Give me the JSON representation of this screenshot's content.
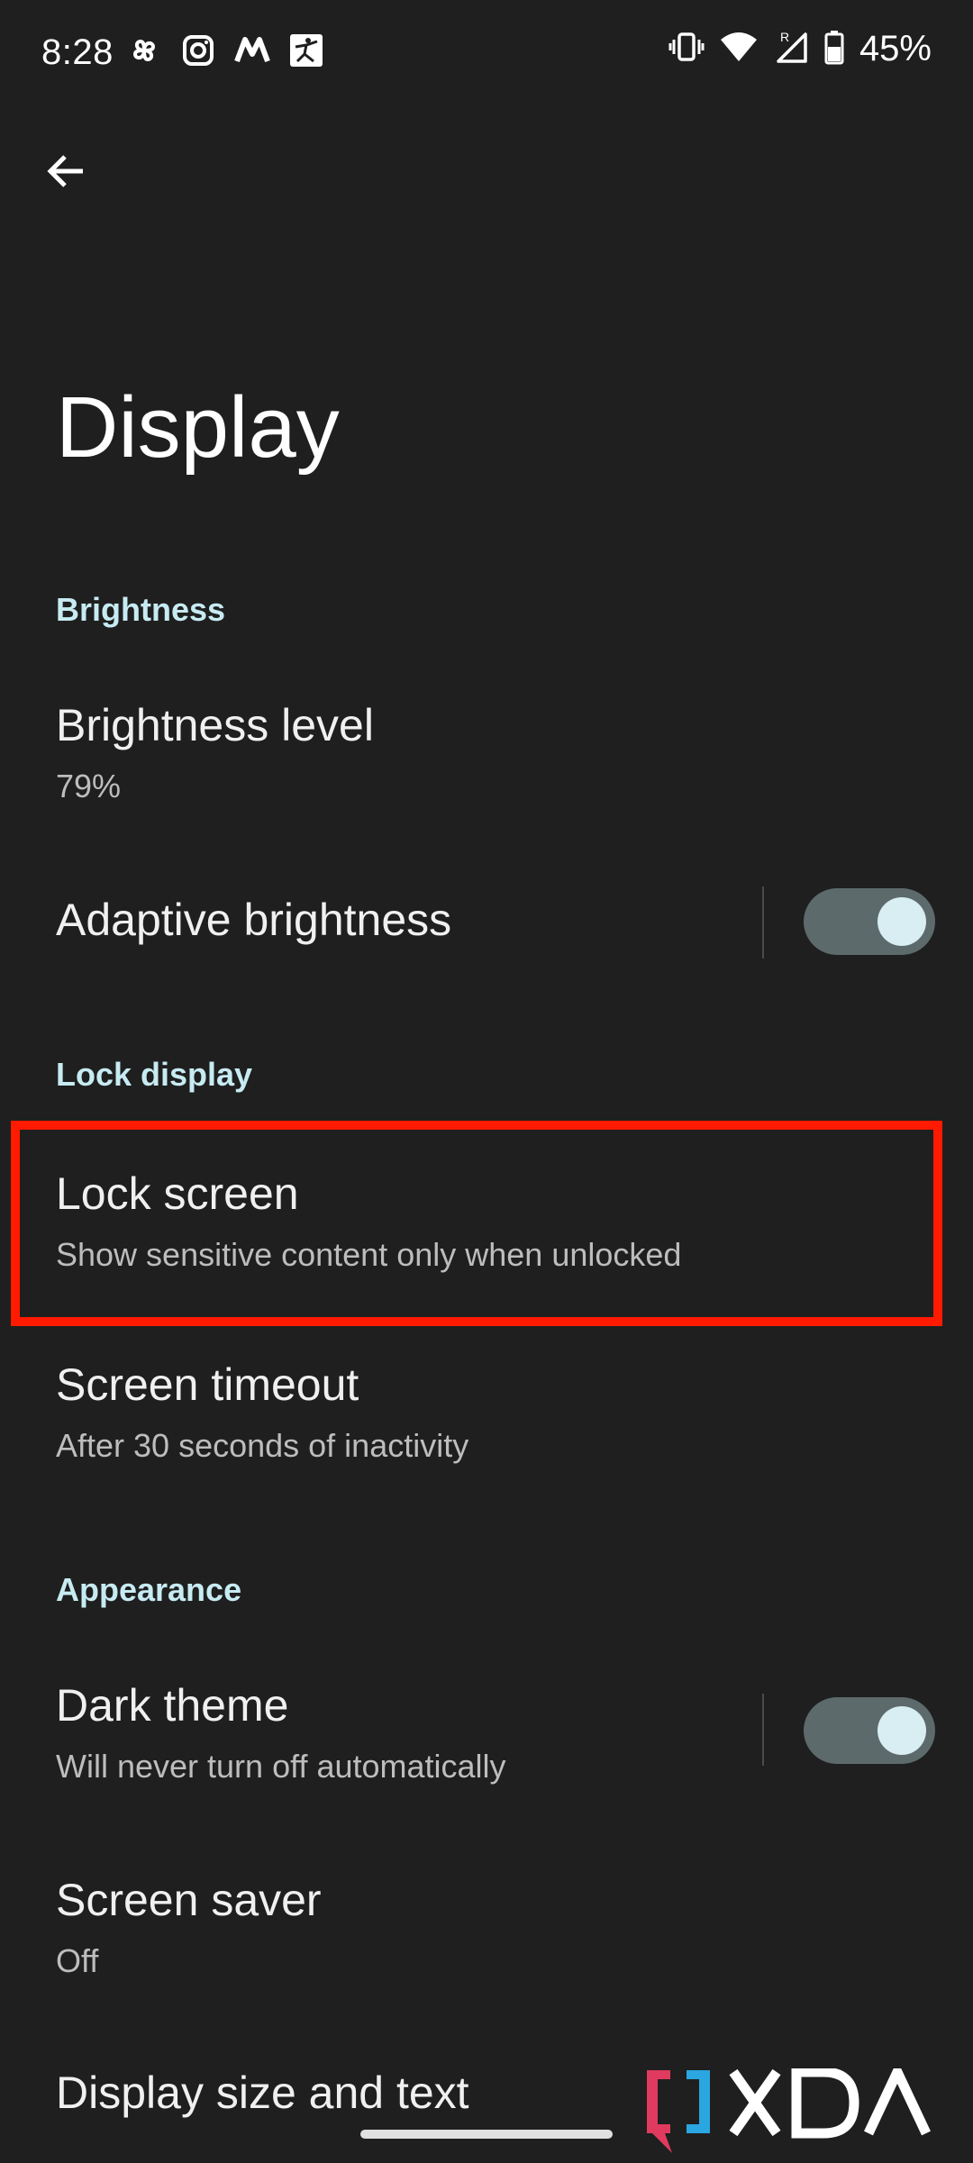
{
  "status_bar": {
    "time": "8:28",
    "notification_icons": [
      "pinwheel-icon",
      "instagram-icon",
      "m-logo-icon",
      "yoga-app-icon"
    ],
    "system_icons": [
      "vibrate-icon",
      "wifi-icon",
      "signal-roaming-icon",
      "battery-icon"
    ],
    "battery_percent": "45%"
  },
  "header": {
    "back_icon": "arrow-left-icon",
    "title": "Display"
  },
  "sections": {
    "brightness": {
      "label": "Brightness",
      "brightness_level": {
        "title": "Brightness level",
        "value": "79%"
      },
      "adaptive_brightness": {
        "title": "Adaptive brightness",
        "enabled": true
      }
    },
    "lock_display": {
      "label": "Lock display",
      "lock_screen": {
        "title": "Lock screen",
        "summary": "Show sensitive content only when unlocked"
      },
      "screen_timeout": {
        "title": "Screen timeout",
        "summary": "After 30 seconds of inactivity"
      }
    },
    "appearance": {
      "label": "Appearance",
      "dark_theme": {
        "title": "Dark theme",
        "summary": "Will never turn off automatically",
        "enabled": true
      },
      "screen_saver": {
        "title": "Screen saver",
        "summary": "Off"
      },
      "display_size": {
        "title": "Display size and text"
      }
    }
  },
  "colors": {
    "background": "#1f1f1f",
    "section_header": "#c7ebf2",
    "highlight_border": "#ff1a00",
    "toggle_track": "#5d6a6c",
    "toggle_knob": "#d8eef2"
  },
  "watermark": {
    "text": "XDA"
  }
}
